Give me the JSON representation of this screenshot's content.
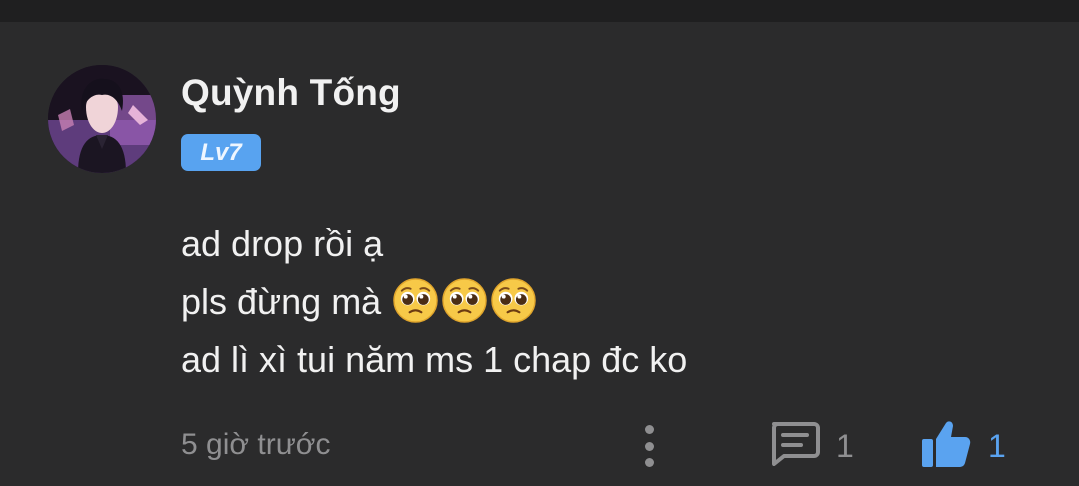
{
  "comment": {
    "author": "Quỳnh Tống",
    "level_badge": "Lv7",
    "lines": [
      "ad drop rồi ạ",
      "pls đừng mà",
      "ad lì xì tui năm ms 1 chap đc ko"
    ],
    "emoji": [
      "pleading-face",
      "pleading-face",
      "pleading-face"
    ],
    "timestamp": "5 giờ trước",
    "reply_count": "1",
    "like_count": "1"
  },
  "colors": {
    "background": "#2b2b2c",
    "badge": "#58a3f0",
    "like_accent": "#5aa3f0",
    "muted_text": "#8f8f91"
  }
}
